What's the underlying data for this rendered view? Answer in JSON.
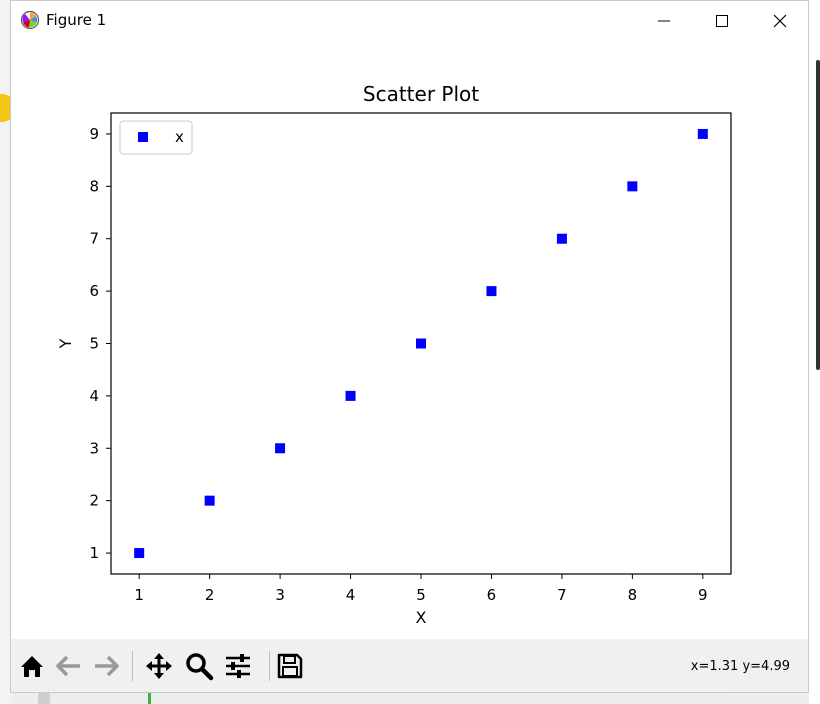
{
  "window": {
    "title": "Figure 1"
  },
  "toolbar": {
    "buttons": [
      "home-icon",
      "back-icon",
      "forward-icon",
      "pan-icon",
      "zoom-icon",
      "configure-icon",
      "save-icon"
    ],
    "coords": "x=1.31 y=4.99"
  },
  "chart_data": {
    "type": "scatter",
    "title": "Scatter Plot",
    "xlabel": "X",
    "ylabel": "Y",
    "x": [
      1,
      2,
      3,
      4,
      5,
      6,
      7,
      8,
      9
    ],
    "y": [
      1,
      2,
      3,
      4,
      5,
      6,
      7,
      8,
      9
    ],
    "xlim": [
      0.6,
      9.4
    ],
    "ylim": [
      0.6,
      9.4
    ],
    "xticks": [
      "1",
      "2",
      "3",
      "4",
      "5",
      "6",
      "7",
      "8",
      "9"
    ],
    "yticks": [
      "1",
      "2",
      "3",
      "4",
      "5",
      "6",
      "7",
      "8",
      "9"
    ],
    "series": [
      {
        "name": "x",
        "marker": "square",
        "color": "#0000ff"
      }
    ],
    "legend": "top-left",
    "grid": false
  }
}
